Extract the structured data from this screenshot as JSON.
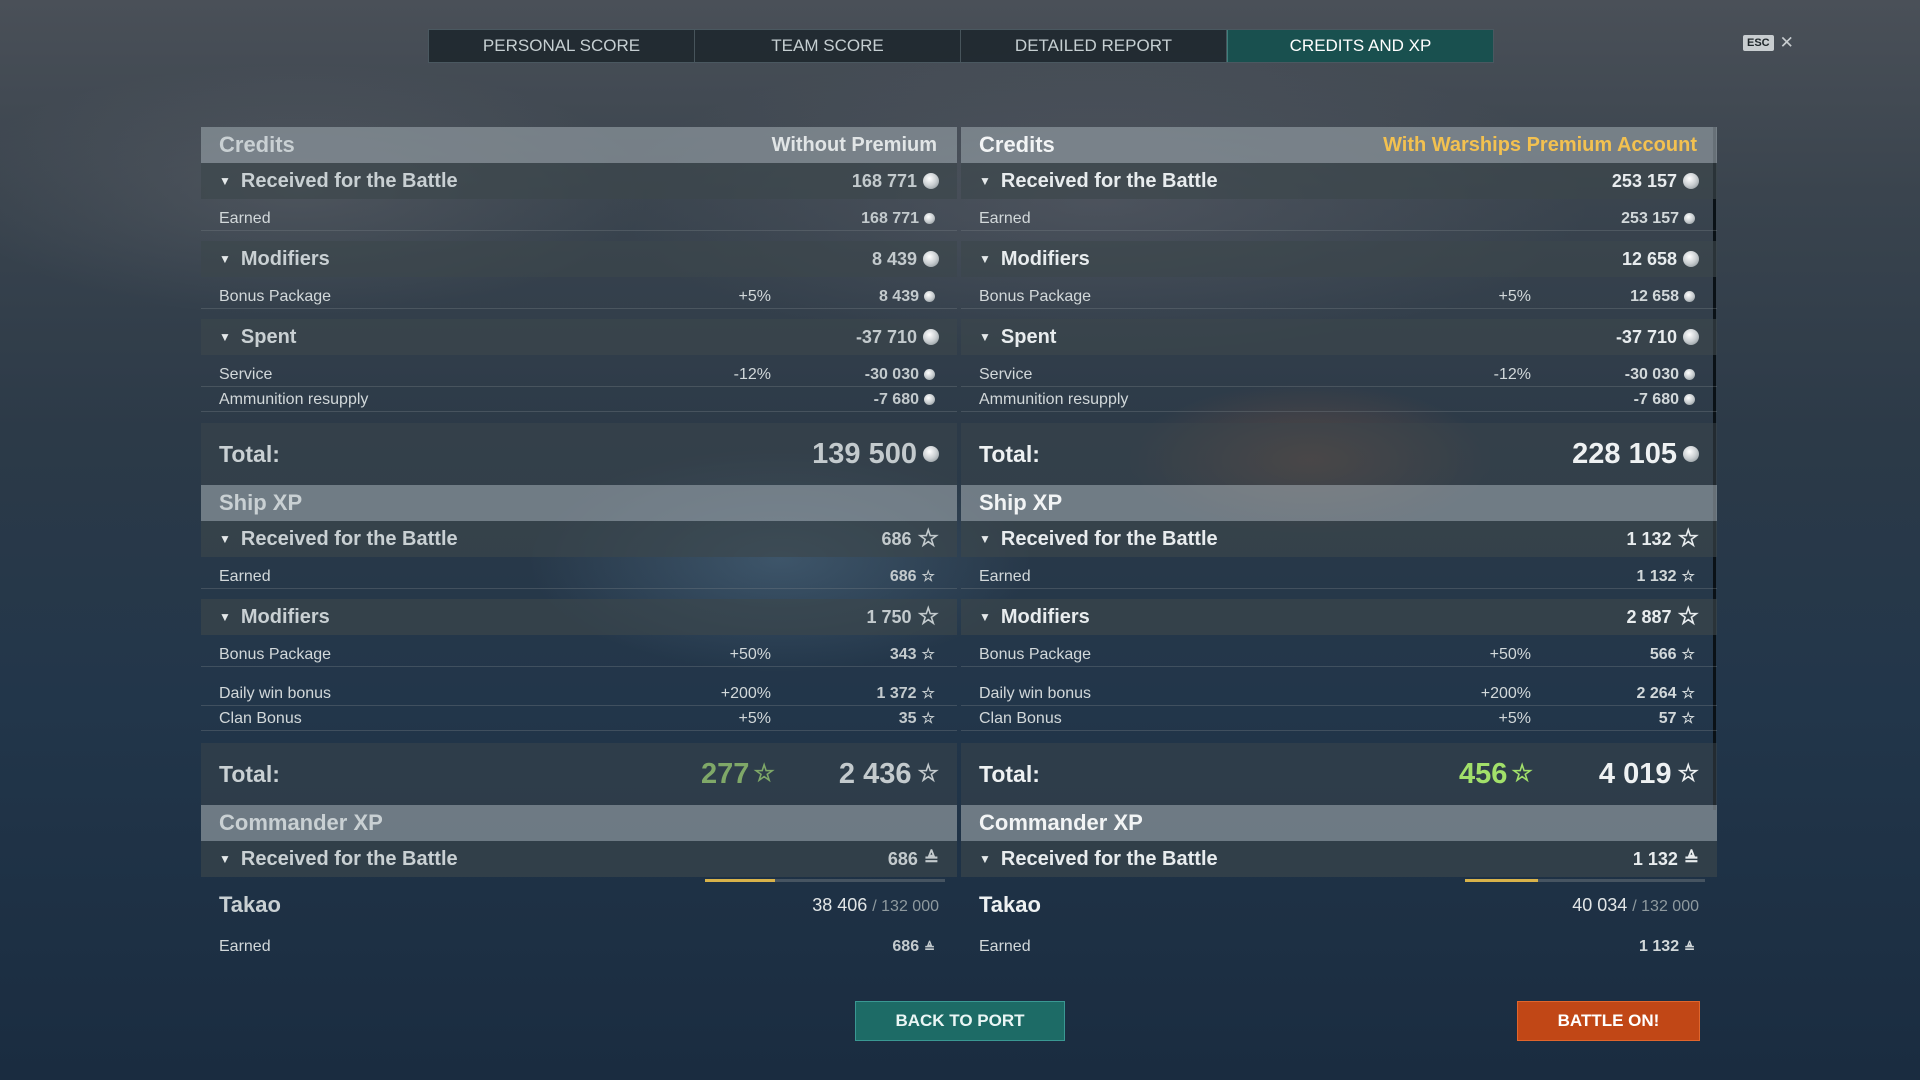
{
  "nav": {
    "tabs": [
      "PERSONAL SCORE",
      "TEAM SCORE",
      "DETAILED REPORT",
      "CREDITS AND XP"
    ],
    "active_tab": "CREDITS AND XP",
    "esc_label": "ESC",
    "close_glyph": "✕"
  },
  "left": {
    "credits_title": "Credits",
    "mode": "Without Premium",
    "received_label": "Received for the Battle",
    "received_value": "168 771",
    "earned_label": "Earned",
    "earned_value": "168 771",
    "modifiers_label": "Modifiers",
    "modifiers_value": "8 439",
    "bonus_label": "Bonus Package",
    "bonus_pct": "+5%",
    "bonus_value": "8 439",
    "spent_label": "Spent",
    "spent_value": "-37 710",
    "service_label": "Service",
    "service_pct": "-12%",
    "service_value": "-30 030",
    "ammo_label": "Ammunition resupply",
    "ammo_value": "-7 680",
    "credits_total_label": "Total:",
    "credits_total": "139 500",
    "shipxp_title": "Ship XP",
    "xp_received_label": "Received for the Battle",
    "xp_received_value": "686",
    "xp_earned_label": "Earned",
    "xp_earned_value": "686",
    "xp_modifiers_label": "Modifiers",
    "xp_modifiers_value": "1 750",
    "xp_bonus_label": "Bonus Package",
    "xp_bonus_pct": "+50%",
    "xp_bonus_value": "343",
    "daily_label": "Daily win bonus",
    "daily_pct": "+200%",
    "daily_value": "1 372",
    "clan_label": "Clan Bonus",
    "clan_pct": "+5%",
    "clan_value": "35",
    "xp_total_label": "Total:",
    "elite_xp": "277",
    "xp_total": "2 436",
    "cmdr_title": "Commander XP",
    "cmdr_received_label": "Received for the Battle",
    "cmdr_received_value": "686",
    "commander_name": "Takao",
    "cmdr_xp_current": "38 406",
    "cmdr_xp_max": "/ 132 000",
    "cmdr_progress": 0.291,
    "cmdr_earned_label": "Earned",
    "cmdr_earned_value": "686"
  },
  "right": {
    "credits_title": "Credits",
    "mode": "With Warships Premium Account",
    "received_label": "Received for the Battle",
    "received_value": "253 157",
    "earned_label": "Earned",
    "earned_value": "253 157",
    "modifiers_label": "Modifiers",
    "modifiers_value": "12 658",
    "bonus_label": "Bonus Package",
    "bonus_pct": "+5%",
    "bonus_value": "12 658",
    "spent_label": "Spent",
    "spent_value": "-37 710",
    "service_label": "Service",
    "service_pct": "-12%",
    "service_value": "-30 030",
    "ammo_label": "Ammunition resupply",
    "ammo_value": "-7 680",
    "credits_total_label": "Total:",
    "credits_total": "228 105",
    "shipxp_title": "Ship XP",
    "xp_received_label": "Received for the Battle",
    "xp_received_value": "1 132",
    "xp_earned_label": "Earned",
    "xp_earned_value": "1 132",
    "xp_modifiers_label": "Modifiers",
    "xp_modifiers_value": "2 887",
    "xp_bonus_label": "Bonus Package",
    "xp_bonus_pct": "+50%",
    "xp_bonus_value": "566",
    "daily_label": "Daily win bonus",
    "daily_pct": "+200%",
    "daily_value": "2 264",
    "clan_label": "Clan Bonus",
    "clan_pct": "+5%",
    "clan_value": "57",
    "xp_total_label": "Total:",
    "elite_xp": "456",
    "xp_total": "4 019",
    "cmdr_title": "Commander XP",
    "cmdr_received_label": "Received for the Battle",
    "cmdr_received_value": "1 132",
    "commander_name": "Takao",
    "cmdr_xp_current": "40 034",
    "cmdr_xp_max": "/ 132 000",
    "cmdr_progress": 0.303,
    "cmdr_earned_label": "Earned",
    "cmdr_earned_value": "1 132"
  },
  "buttons": {
    "back_to_port": "BACK TO PORT",
    "battle_on": "BATTLE ON!"
  },
  "icons": {
    "credits": "credit-coin-icon",
    "ship_xp": "star-icon",
    "commander_xp": "commander-icon",
    "collapse": "triangle-down-icon"
  },
  "colors": {
    "premium_label": "#f3c150",
    "elite_xp_dim": "#7fa868",
    "elite_xp_lit": "#a2e06a",
    "active_tab": "#19504f",
    "port_button": "#1d6b66",
    "battle_button": "#c14716"
  }
}
